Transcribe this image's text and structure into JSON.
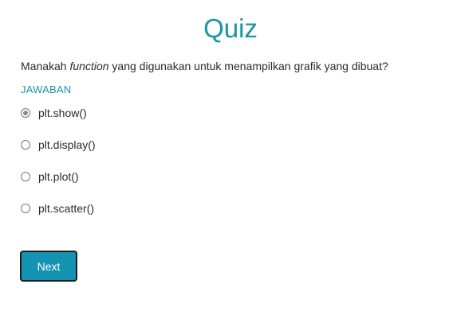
{
  "quiz": {
    "title": "Quiz",
    "question": {
      "prefix": "Manakah ",
      "emphasis": "function",
      "suffix": " yang digunakan untuk menampilkan grafik yang dibuat?"
    },
    "answer_label": "JAWABAN",
    "options": [
      {
        "label": "plt.show()",
        "selected": true
      },
      {
        "label": "plt.display()",
        "selected": false
      },
      {
        "label": "plt.plot()",
        "selected": false
      },
      {
        "label": "plt.scatter()",
        "selected": false
      }
    ],
    "next_label": "Next"
  },
  "colors": {
    "accent": "#1a93a8",
    "button": "#1593b3",
    "text": "#2b2b2b"
  }
}
